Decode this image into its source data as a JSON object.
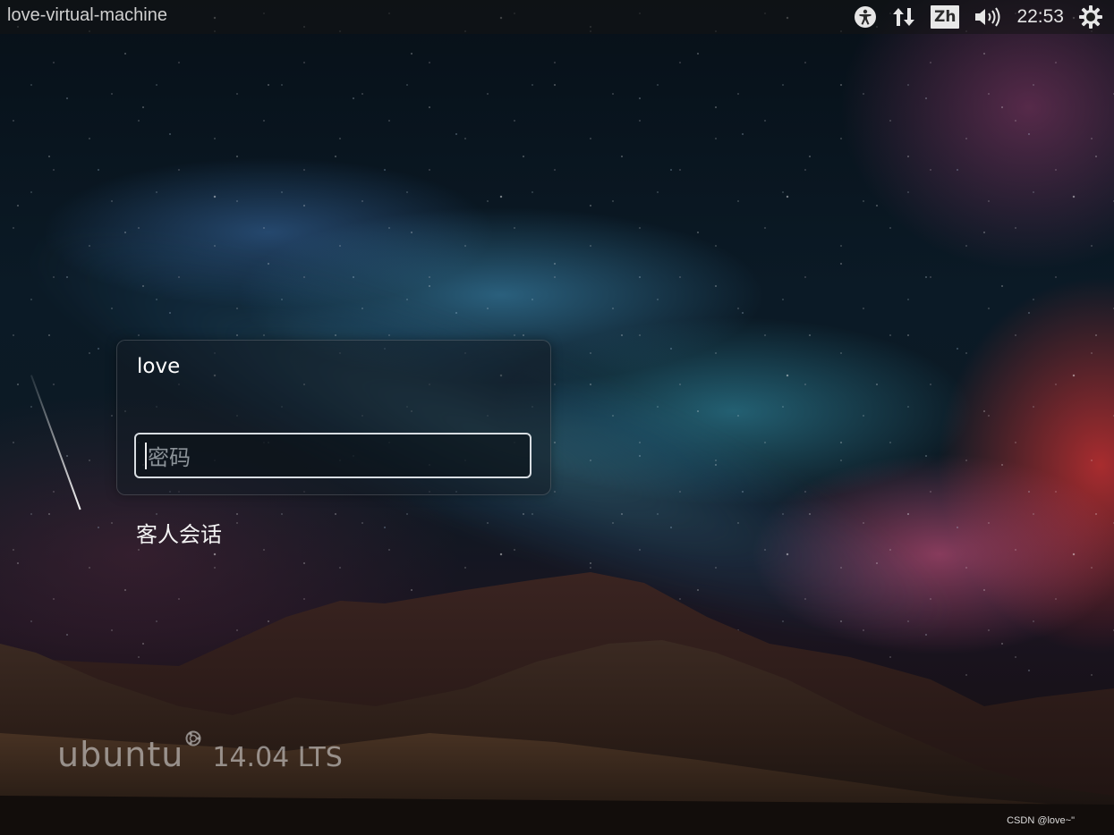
{
  "top_panel": {
    "hostname": "love-virtual-machine",
    "indicators": {
      "accessibility_icon": "accessibility-icon",
      "network_icon": "network-arrows-icon",
      "keyboard_layout": "Zh",
      "volume_icon": "volume-icon",
      "clock": "22:53",
      "power_icon": "power-gear-icon"
    }
  },
  "login": {
    "user_name": "love",
    "password_placeholder": "密码",
    "guest_session_label": "客人会话"
  },
  "branding": {
    "word": "ubuntu",
    "version": "14.04 LTS"
  },
  "watermark": "CSDN @love~\""
}
